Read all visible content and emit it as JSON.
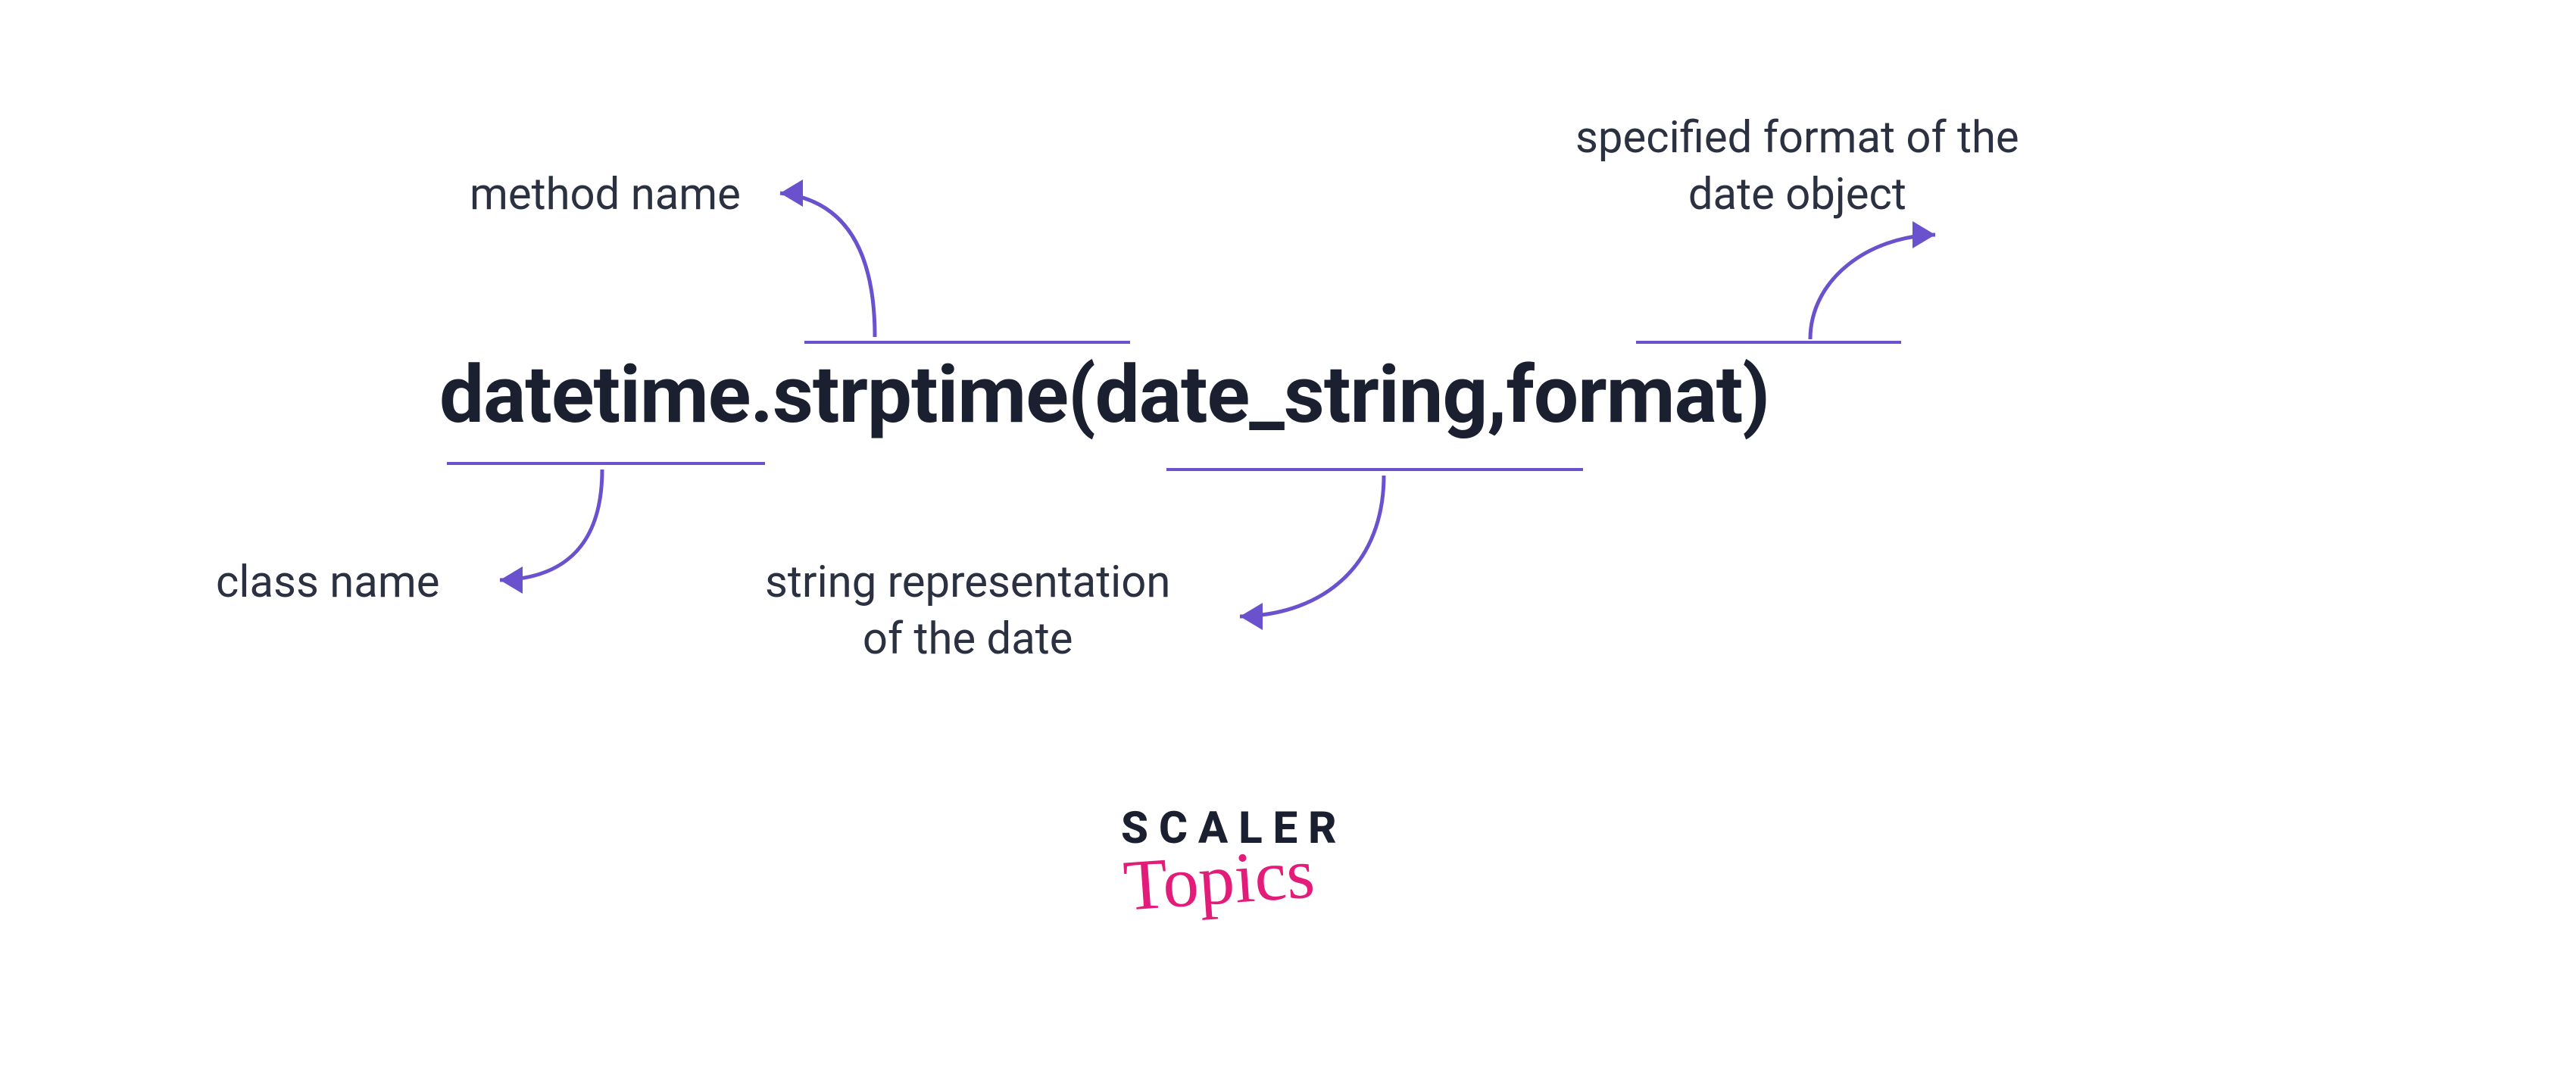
{
  "labels": {
    "method_name": "method name",
    "class_name": "class name",
    "string_rep_l1": "string representation",
    "string_rep_l2": "of the date",
    "format_l1": "specified format of the",
    "format_l2": "date object"
  },
  "expr": {
    "class": "datetime",
    "dot": ".",
    "method": "strptime",
    "open": "(",
    "arg1": "date_string",
    "comma": ",",
    "space": " ",
    "arg2": "format",
    "close": ")"
  },
  "logo": {
    "line1": "SCALER",
    "line2": "Topics"
  },
  "colors": {
    "text": "#1b2030",
    "accent": "#6a52cf",
    "brand_pink": "#e31c79"
  }
}
